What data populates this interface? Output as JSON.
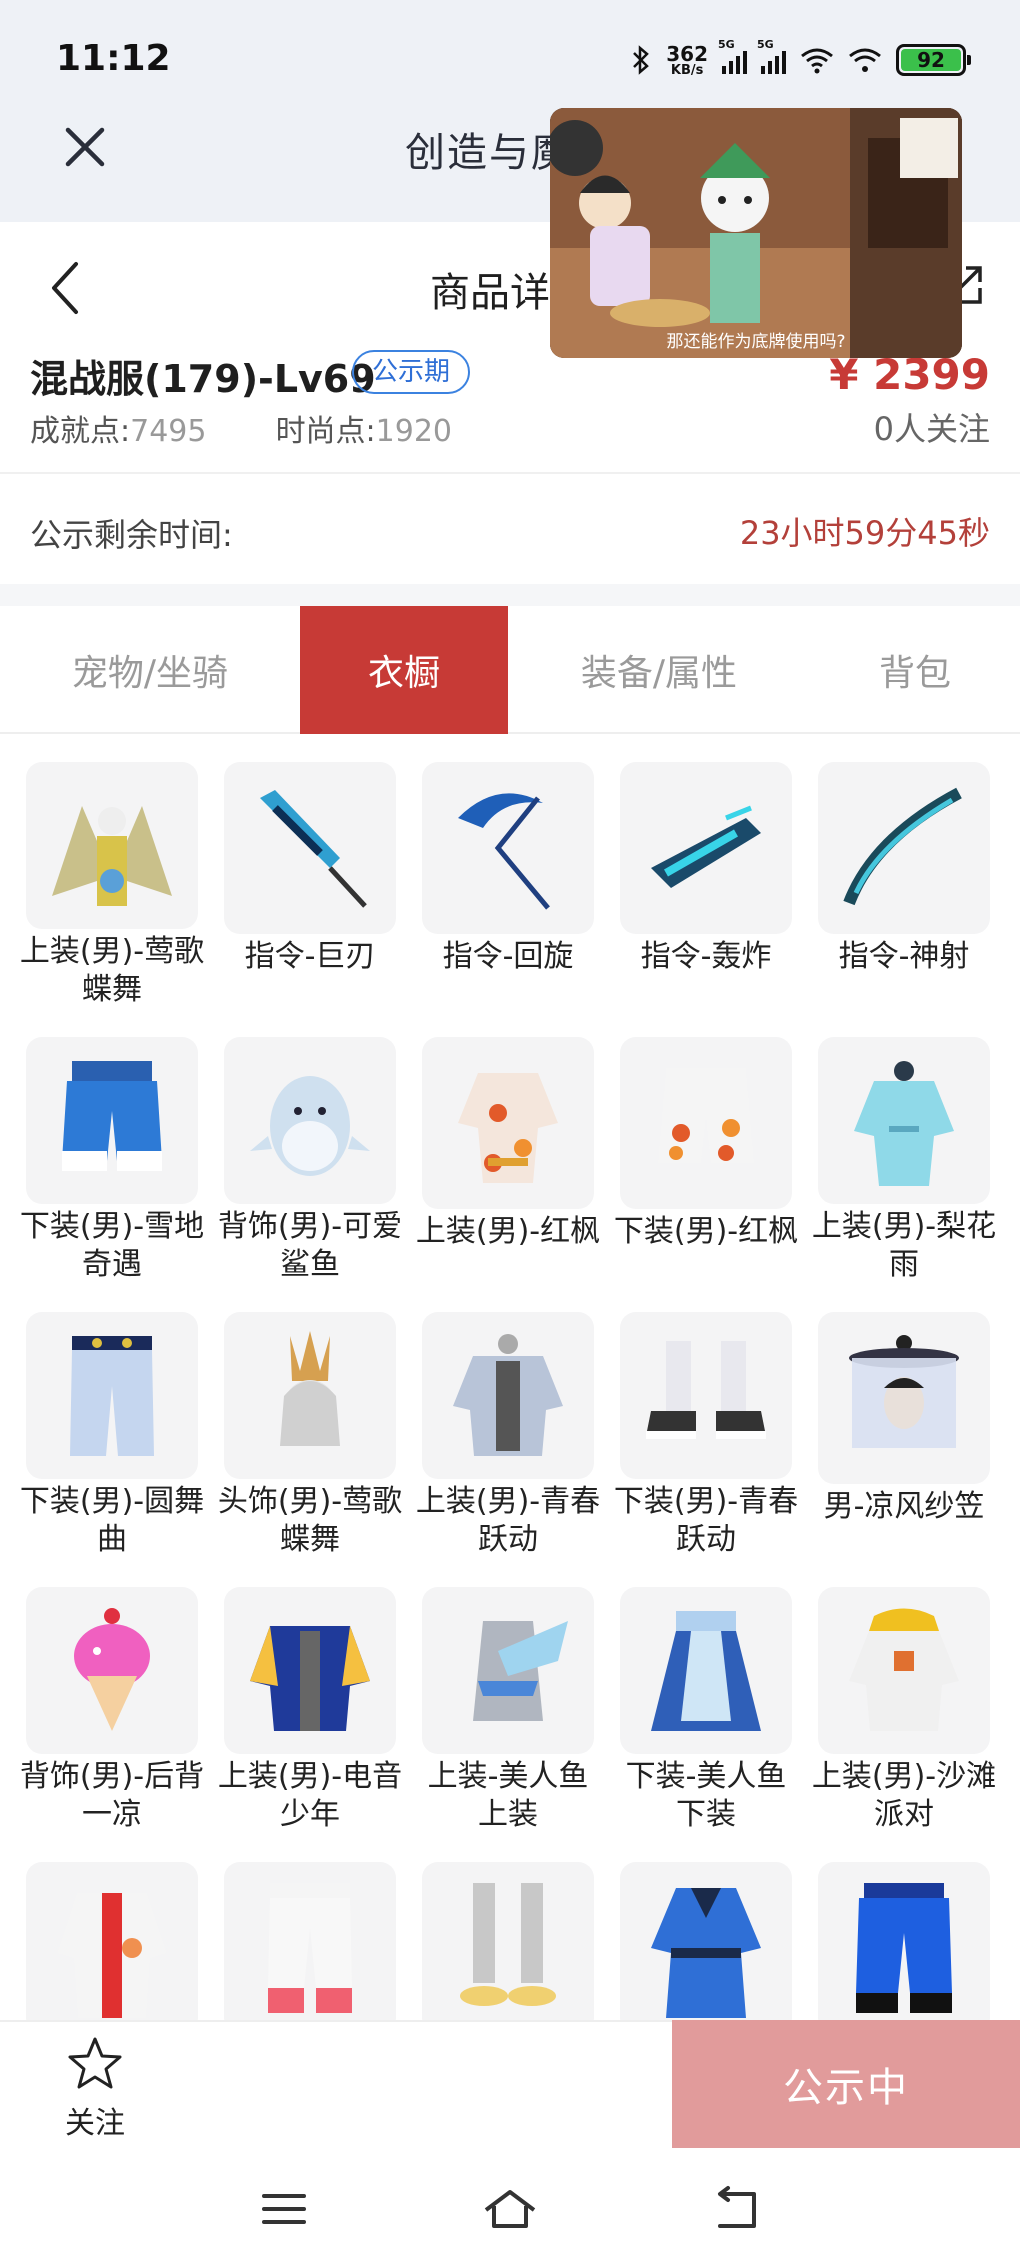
{
  "status_bar": {
    "time": "11:12",
    "net_speed": "362",
    "net_speed_unit": "KB/s",
    "signal_label": "5G",
    "battery": "92"
  },
  "nav": {
    "title": "创造与魔法",
    "page_title": "商品详情"
  },
  "product": {
    "name": "混战服(179)-Lv69",
    "badge": "公示期",
    "price": "¥ 2399",
    "achievement_label": "成就点:",
    "achievement_value": "7495",
    "fashion_label": "时尚点:",
    "fashion_value": "1920",
    "followers": "0人关注"
  },
  "countdown": {
    "label": "公示剩余时间:",
    "value": "23小时59分45秒"
  },
  "tabs": [
    {
      "label": "宠物/坐骑",
      "active": false
    },
    {
      "label": "衣橱",
      "active": true
    },
    {
      "label": "装备/属性",
      "active": false
    },
    {
      "label": "背包",
      "active": false
    }
  ],
  "items": [
    {
      "label": "上装(男)-莺歌蝶舞",
      "icon": "winged-outfit-icon"
    },
    {
      "label": "指令-巨刃",
      "icon": "great-blade-icon"
    },
    {
      "label": "指令-回旋",
      "icon": "scythe-icon"
    },
    {
      "label": "指令-轰炸",
      "icon": "bomber-icon"
    },
    {
      "label": "指令-神射",
      "icon": "bow-icon"
    },
    {
      "label": "下装(男)-雪地奇遇",
      "icon": "snow-shorts-icon"
    },
    {
      "label": "背饰(男)-可爱鲨鱼",
      "icon": "shark-backpack-icon"
    },
    {
      "label": "上装(男)-红枫",
      "icon": "maple-robe-icon"
    },
    {
      "label": "下装(男)-红枫",
      "icon": "maple-shorts-icon"
    },
    {
      "label": "上装(男)-梨花雨",
      "icon": "pear-blossom-robe-icon"
    },
    {
      "label": "下装(男)-圆舞曲",
      "icon": "waltz-pants-icon"
    },
    {
      "label": "头饰(男)-莺歌蝶舞",
      "icon": "feather-headdress-icon"
    },
    {
      "label": "上装(男)-青春跃动",
      "icon": "youth-jacket-icon"
    },
    {
      "label": "下装(男)-青春跃动",
      "icon": "sneakers-icon"
    },
    {
      "label": "男-凉风纱笠",
      "icon": "veil-hat-icon"
    },
    {
      "label": "背饰(男)-后背一凉",
      "icon": "ice-cream-icon"
    },
    {
      "label": "上装(男)-电音少年",
      "icon": "varsity-jacket-icon"
    },
    {
      "label": "上装-美人鱼上装",
      "icon": "mermaid-top-icon"
    },
    {
      "label": "下装-美人鱼下装",
      "icon": "mermaid-skirt-icon"
    },
    {
      "label": "上装(男)-沙滩派对",
      "icon": "beach-hoodie-icon"
    },
    {
      "label": "",
      "icon": "fox-jacket-icon"
    },
    {
      "label": "",
      "icon": "white-pants-icon"
    },
    {
      "label": "",
      "icon": "sandals-icon"
    },
    {
      "label": "",
      "icon": "blue-robe-icon"
    },
    {
      "label": "",
      "icon": "blue-pants-icon"
    }
  ],
  "bottom": {
    "favorite_label": "关注",
    "action_label": "公示中"
  },
  "overlay": {
    "caption": "那还能作为底牌使用吗?"
  },
  "colors": {
    "accent": "#c73a36",
    "badge_blue": "#3b82e0",
    "action_disabled": "#e19b9b",
    "header_bg": "#eef1f6"
  }
}
